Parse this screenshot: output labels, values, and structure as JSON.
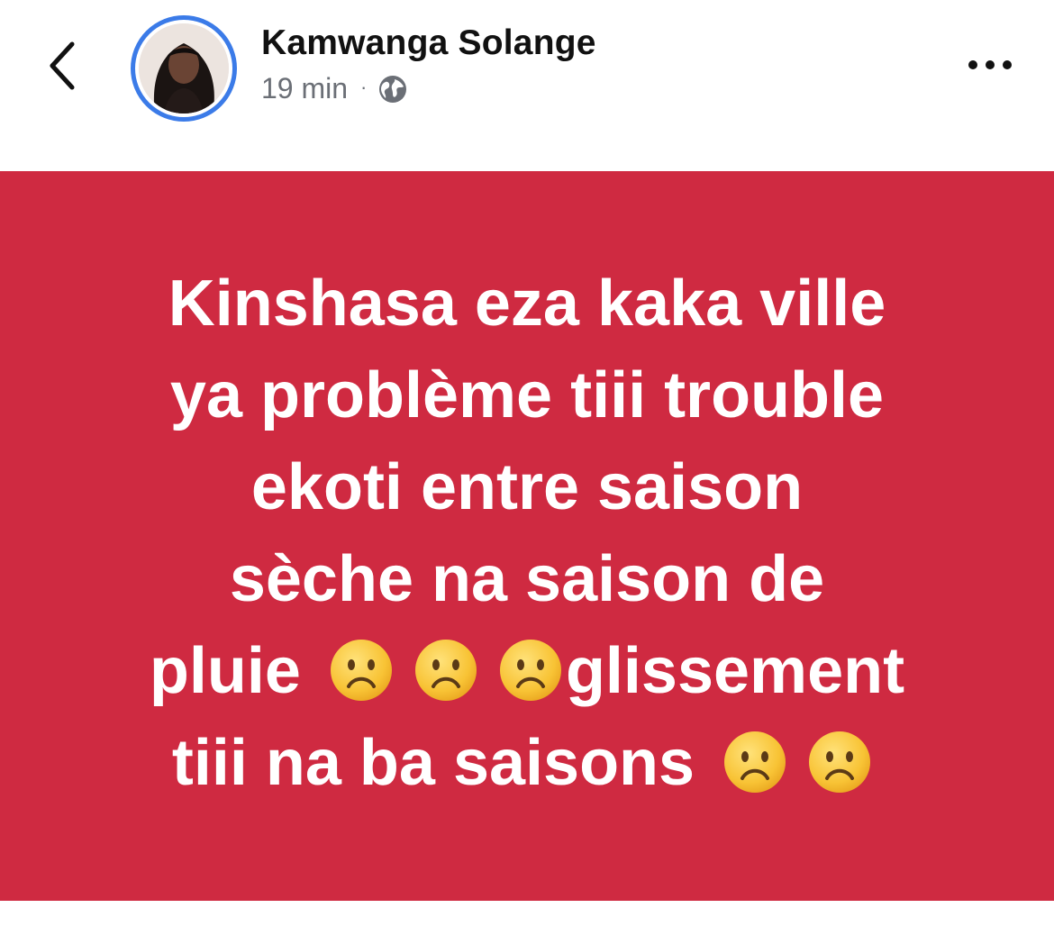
{
  "post": {
    "author": "Kamwanga Solange",
    "time": "19 min",
    "separator": "·",
    "audience_icon": "globe-icon",
    "lines": [
      {
        "text_before": "Kinshasa eza kaka ville",
        "emojis_mid": 0,
        "text_after": "",
        "emojis_end": 0
      },
      {
        "text_before": "ya problème tiii trouble",
        "emojis_mid": 0,
        "text_after": "",
        "emojis_end": 0
      },
      {
        "text_before": "ekoti entre saison",
        "emojis_mid": 0,
        "text_after": "",
        "emojis_end": 0
      },
      {
        "text_before": "sèche na saison de",
        "emojis_mid": 0,
        "text_after": "",
        "emojis_end": 0
      },
      {
        "text_before": "pluie",
        "emojis_mid": 3,
        "text_after": "glissement",
        "emojis_end": 0
      },
      {
        "text_before": "tiii na ba saisons",
        "emojis_mid": 0,
        "text_after": "",
        "emojis_end": 2
      }
    ],
    "background_color": "#cf2a41",
    "text_color": "#ffffff",
    "emoji_name": "frowning-face-emoji"
  },
  "header": {
    "back_icon": "chevron-left-icon",
    "more_icon": "more-options-icon",
    "avatar_ring_color": "#3b7be8"
  }
}
